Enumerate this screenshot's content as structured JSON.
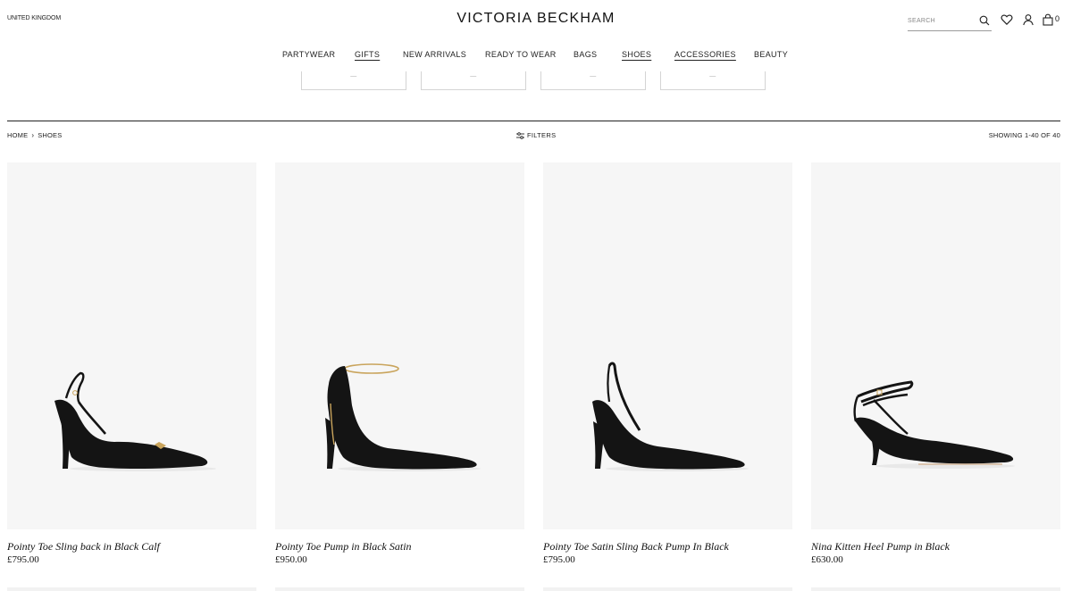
{
  "header": {
    "region": "UNITED KINGDOM",
    "brand": "VICTORIA BECKHAM",
    "search_placeholder": "SEARCH",
    "bag_count": "0",
    "icons": [
      "search-icon",
      "heart-icon",
      "user-icon",
      "bag-icon"
    ]
  },
  "nav": {
    "items": [
      {
        "label": "PARTYWEAR"
      },
      {
        "label": "GIFTS"
      },
      {
        "label": "NEW ARRIVALS"
      },
      {
        "label": "READY TO WEAR"
      },
      {
        "label": "BAGS"
      },
      {
        "label": "SHOES"
      },
      {
        "label": "ACCESSORIES"
      },
      {
        "label": "BEAUTY"
      }
    ]
  },
  "toolbar": {
    "breadcrumb": [
      "HOME",
      "SHOES"
    ],
    "breadcrumb_separator": "›",
    "filters_label": "FILTERS",
    "showing": "SHOWING 1-40 OF 40"
  },
  "products": [
    {
      "name": "Pointy Toe Sling back in Black Calf",
      "price": "£795.00"
    },
    {
      "name": "Pointy Toe Pump in Black Satin",
      "price": "£950.00"
    },
    {
      "name": "Pointy Toe Satin Sling Back Pump In Black",
      "price": "£795.00"
    },
    {
      "name": "Nina Kitten Heel Pump in Black",
      "price": "£630.00"
    }
  ],
  "colors": {
    "text": "#1a1a1a",
    "image_bg": "#f6f6f6",
    "rule": "#222222",
    "shoe": "#141414",
    "gold": "#c9a45c"
  }
}
